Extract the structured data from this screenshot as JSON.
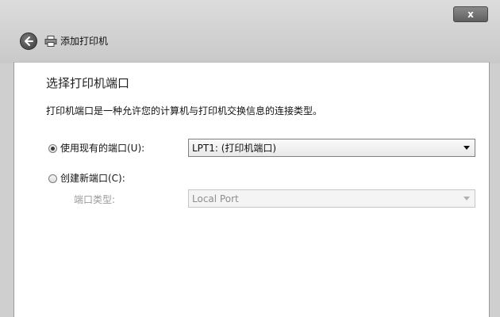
{
  "window": {
    "close_glyph": "x",
    "nav_title": "添加打印机",
    "icons": {
      "back": "back-arrow-icon",
      "printer": "printer-icon",
      "close": "close-icon"
    }
  },
  "page": {
    "heading": "选择打印机端口",
    "description": "打印机端口是一种允许您的计算机与打印机交换信息的连接类型。"
  },
  "options": {
    "use_existing": {
      "label": "使用现有的端口(U):",
      "selected": true,
      "dropdown_value": "LPT1: (打印机端口)"
    },
    "create_new": {
      "label": "创建新端口(C):",
      "selected": false,
      "port_type_label": "端口类型:",
      "port_type_value": "Local Port"
    }
  },
  "colors": {
    "frame": "#cfcfcf",
    "content_bg": "#ffffff",
    "disabled_text": "#9a9a9a"
  }
}
